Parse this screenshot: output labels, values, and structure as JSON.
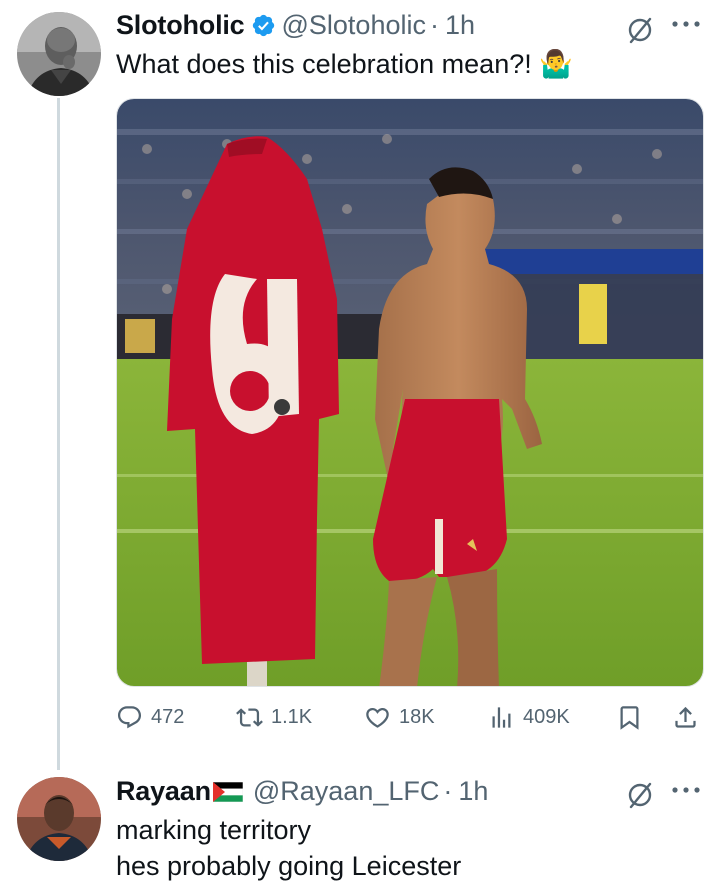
{
  "tweet": {
    "author": {
      "display_name": "Slotoholic",
      "handle": "@Slotoholic",
      "verified": true
    },
    "separator": "·",
    "time": "1h",
    "text": "What does this celebration mean?! 🤷‍♂️",
    "stats": {
      "replies": "472",
      "reposts": "1.1K",
      "likes": "18K",
      "views": "409K"
    }
  },
  "reply": {
    "author": {
      "display_name": "Rayaan",
      "handle": "@Rayaan_LFC"
    },
    "separator": "·",
    "time": "1h",
    "text_lines": [
      "marking territory",
      "hes probably going Leicester"
    ]
  },
  "colors": {
    "text_primary": "#0f1419",
    "text_secondary": "#536471",
    "verified_blue": "#1d9bf0",
    "thread_line": "#cfd9de",
    "pitch_green": "#7faa2e",
    "kit_red": "#c8102e"
  },
  "icons": {
    "verified": "verified-badge-icon",
    "grok": "grok-icon",
    "more": "more-icon",
    "reply": "reply-icon",
    "repost": "repost-icon",
    "like": "heart-icon",
    "views": "views-icon",
    "bookmark": "bookmark-icon",
    "share": "share-icon"
  }
}
